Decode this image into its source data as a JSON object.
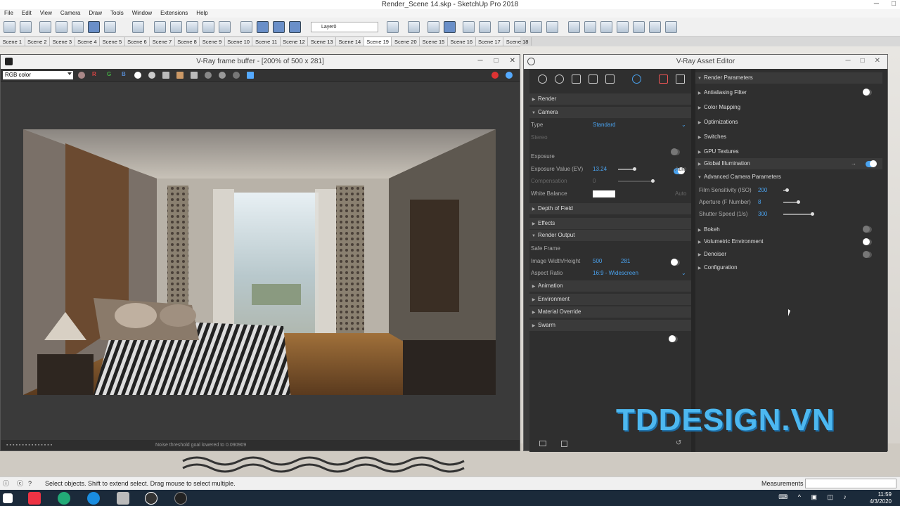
{
  "window_title": "Render_Scene 14.skp - SketchUp Pro 2018",
  "menu": [
    "File",
    "Edit",
    "View",
    "Camera",
    "Draw",
    "Tools",
    "Window",
    "Extensions",
    "Help"
  ],
  "layer": "Layer0",
  "scenes": [
    "Scene 1",
    "Scene 2",
    "Scene 3",
    "Scene 4",
    "Scene 5",
    "Scene 6",
    "Scene 7",
    "Scene 8",
    "Scene 9",
    "Scene 10",
    "Scene 11",
    "Scene 12",
    "Scene 13",
    "Scene 14",
    "Scene 19",
    "Scene 20",
    "Scene 15",
    "Scene 16",
    "Scene 17",
    "Scene 18"
  ],
  "active_scene": "Scene 19",
  "vfb": {
    "title": "V-Ray frame buffer - [200% of 500 x 281]",
    "channel": "RGB color",
    "status": "Noise threshold goal lowered to 0.090909",
    "r": "R",
    "g": "G",
    "b": "B"
  },
  "ase": {
    "title": "V-Ray Asset Editor",
    "left": {
      "render": "Render",
      "camera": "Camera",
      "type_label": "Type",
      "type_value": "Standard",
      "stereo": "Stereo",
      "exposure": "Exposure",
      "ev_label": "Exposure Value (EV)",
      "ev_value": "13.24",
      "auto": "Auto",
      "comp_label": "Compensation",
      "comp_value": "0",
      "wb_label": "White Balance",
      "dof": "Depth of Field",
      "effects": "Effects",
      "render_output": "Render Output",
      "safe_frame": "Safe Frame",
      "wh_label": "Image Width/Height",
      "width": "500",
      "height": "281",
      "ar_label": "Aspect Ratio",
      "ar_value": "16:9 - Widescreen",
      "animation": "Animation",
      "environment": "Environment",
      "material_override": "Material Override",
      "swarm": "Swarm"
    },
    "right": {
      "render_params": "Render Parameters",
      "aa": "Antialiasing Filter",
      "color_mapping": "Color Mapping",
      "optimizations": "Optimizations",
      "switches": "Switches",
      "gpu": "GPU Textures",
      "gi": "Global Illumination",
      "acp": "Advanced Camera Parameters",
      "iso_label": "Film Sensitivity (ISO)",
      "iso": "200",
      "fnum_label": "Aperture (F Number)",
      "fnum": "8",
      "shutter_label": "Shutter Speed (1/s)",
      "shutter": "300",
      "bokeh": "Bokeh",
      "vol": "Volumetric Environment",
      "denoiser": "Denoiser",
      "config": "Configuration"
    }
  },
  "watermark": "TDDESIGN.VN",
  "status_hint": "Select objects. Shift to extend select. Drag mouse to select multiple.",
  "measurements": "Measurements",
  "clock": {
    "time": "11:59",
    "date": "4/3/2020"
  },
  "icons": [
    "sketchup-logo-icon",
    "vray-logo-icon",
    "windows-start-icon",
    "chrome-icon",
    "skype-icon"
  ]
}
